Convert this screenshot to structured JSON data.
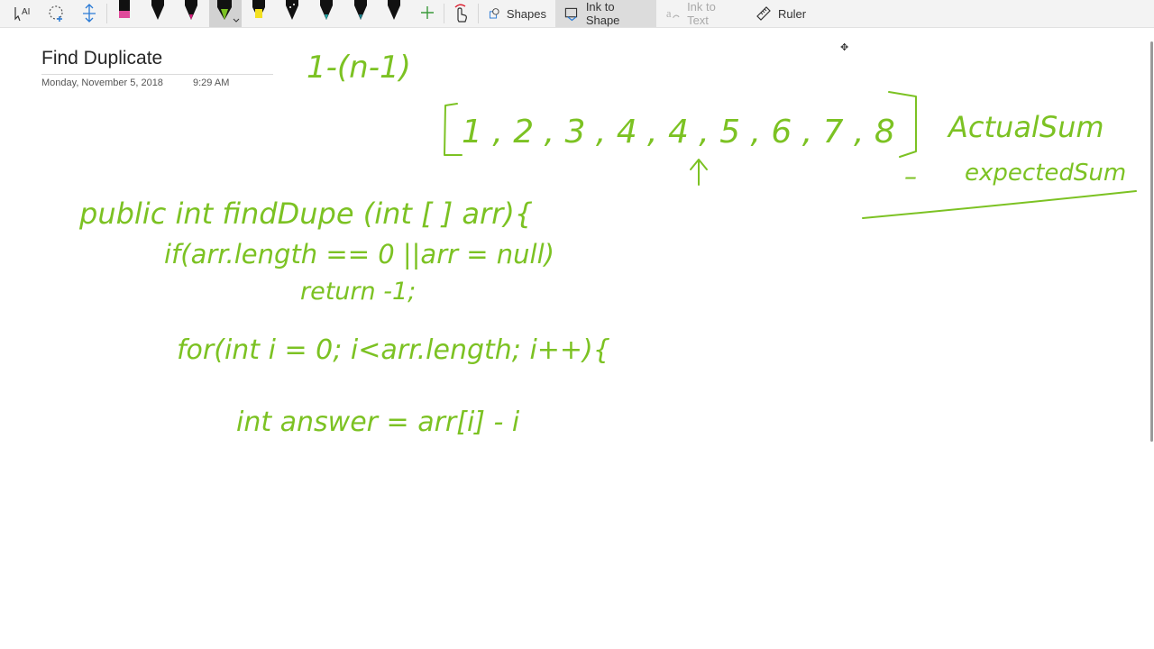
{
  "toolbar": {
    "shapes_label": "Shapes",
    "ink_to_shape_label": "Ink to Shape",
    "ink_to_text_label": "Ink to Text",
    "ruler_label": "Ruler",
    "ink_color": "#7cc223"
  },
  "page": {
    "title": "Find Duplicate",
    "date": "Monday, November 5, 2018",
    "time": "9:29 AM"
  },
  "ink": {
    "range_note": "1-(n-1)",
    "array": "1 , 2 , 3 , 4 , 4 , 5 , 6 , 7 , 8",
    "actual_sum": "ActualSum",
    "minus": "–",
    "expected_sum": "expectedSum",
    "code_line_1": "public int findDupe (int [ ] arr){",
    "code_line_2": "if(arr.length == 0  ||arr = null)",
    "code_line_3": "return -1;",
    "code_line_4": "for(int i = 0; i<arr.length; i++){",
    "code_line_5": "int answer = arr[i] - i"
  }
}
